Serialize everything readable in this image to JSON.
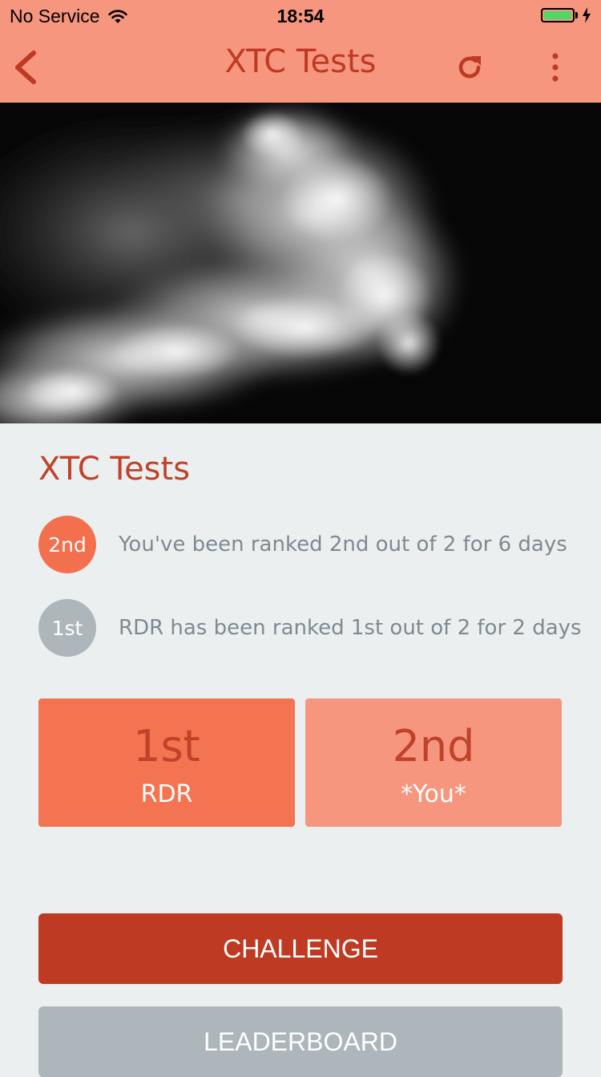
{
  "status_bar": {
    "carrier": "No Service",
    "time": "18:54",
    "battery_color": "#4CD964"
  },
  "nav": {
    "title": "XTC Tests",
    "back_icon": "chevron-left-icon",
    "refresh_icon": "refresh-icon",
    "more_icon": "more-vertical-icon"
  },
  "section": {
    "title": "XTC Tests"
  },
  "rankings": [
    {
      "badge": "2nd",
      "text": "You've been ranked 2nd out of 2 for 6 days",
      "color": "#F2704D"
    },
    {
      "badge": "1st",
      "text": "RDR has been ranked 1st out of 2 for 2 days",
      "color": "#ADB6BA"
    }
  ],
  "cards": [
    {
      "place": "1st",
      "name": "RDR",
      "color": "#F47350"
    },
    {
      "place": "2nd",
      "name": "*You*",
      "color": "#F7967E"
    }
  ],
  "buttons": {
    "challenge": "CHALLENGE",
    "leaderboard": "LEADERBOARD"
  },
  "colors": {
    "header": "#F7967E",
    "accent": "#BE3A22",
    "challenge": "#BE3A22",
    "leaderboard": "#ADB6BA",
    "background": "#ECEFF0"
  }
}
